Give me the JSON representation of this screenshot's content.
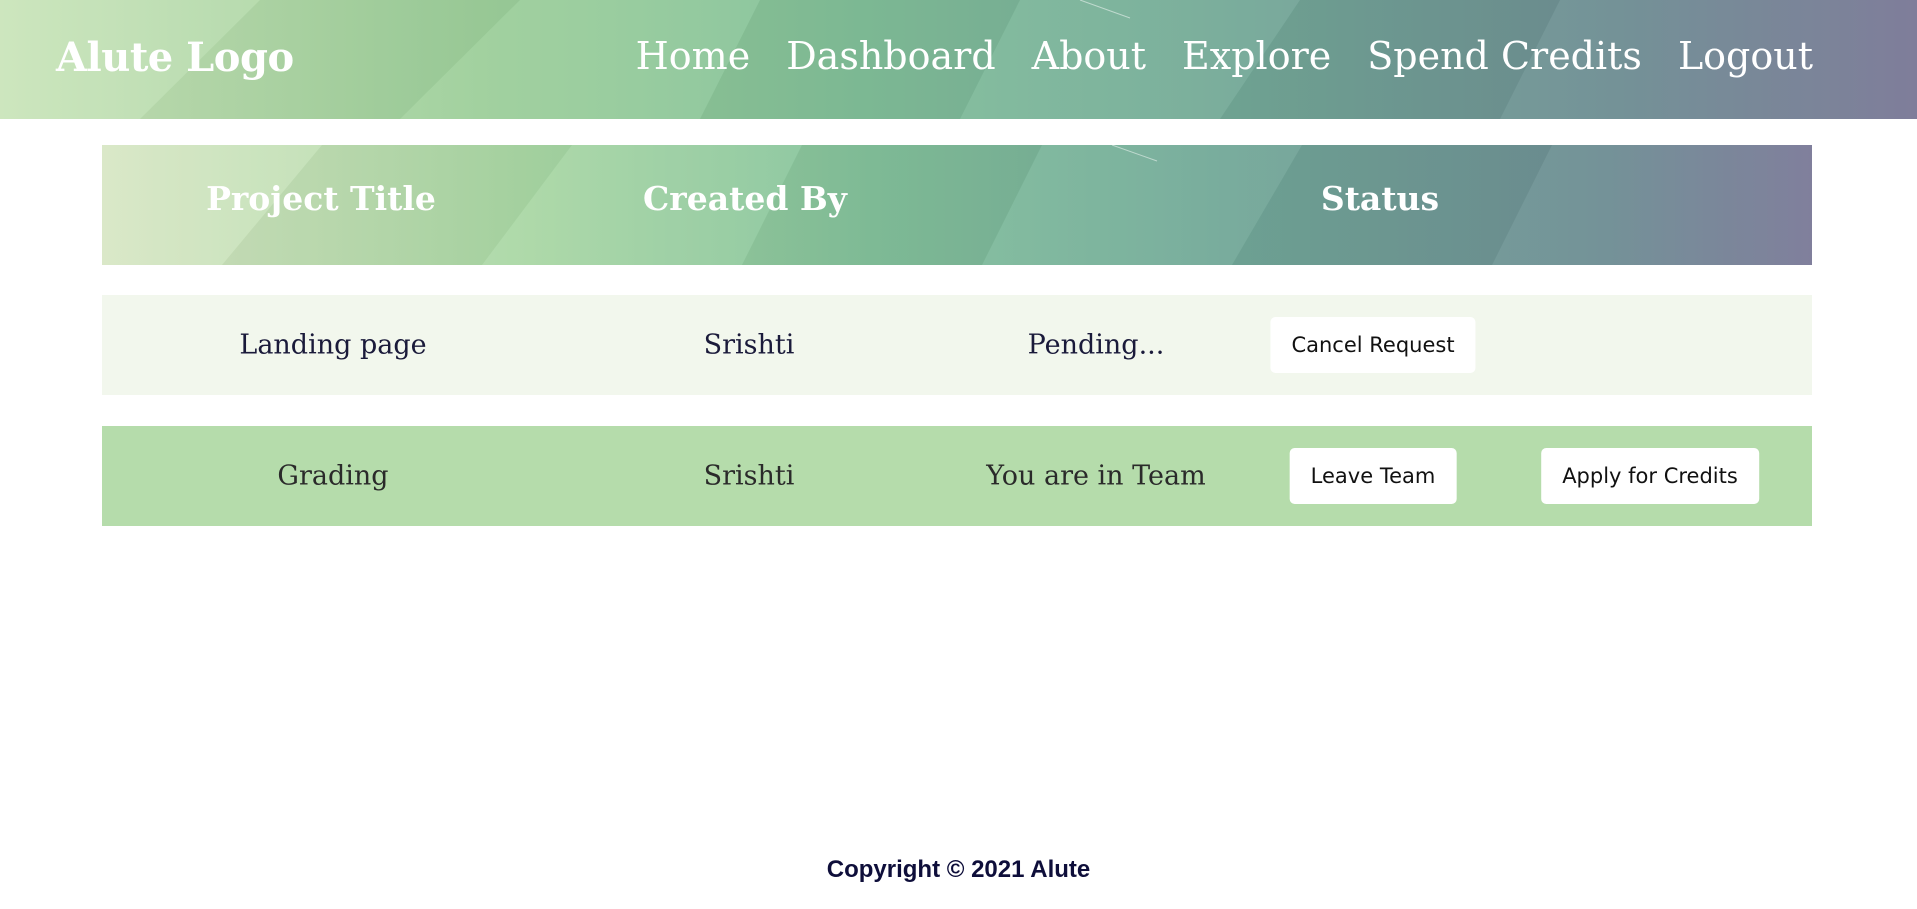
{
  "navbar": {
    "logo": "Alute Logo",
    "links": [
      "Home",
      "Dashboard",
      "About",
      "Explore",
      "Spend Credits",
      "Logout"
    ]
  },
  "table": {
    "headers": [
      "Project Title",
      "Created By",
      "Status"
    ],
    "rows": [
      {
        "title": "Landing page",
        "created_by": "Srishti",
        "status": "Pending...",
        "actions": [
          "Cancel Request"
        ]
      },
      {
        "title": "Grading",
        "created_by": "Srishti",
        "status": "You are in Team",
        "actions": [
          "Leave Team",
          "Apply for Credits"
        ]
      }
    ]
  },
  "footer": {
    "copyright": "Copyright © 2021 Alute"
  },
  "colors": {
    "row_light": "#f2f7ed",
    "row_green": "#b5dcab",
    "footer_text": "#0e0e3a"
  }
}
